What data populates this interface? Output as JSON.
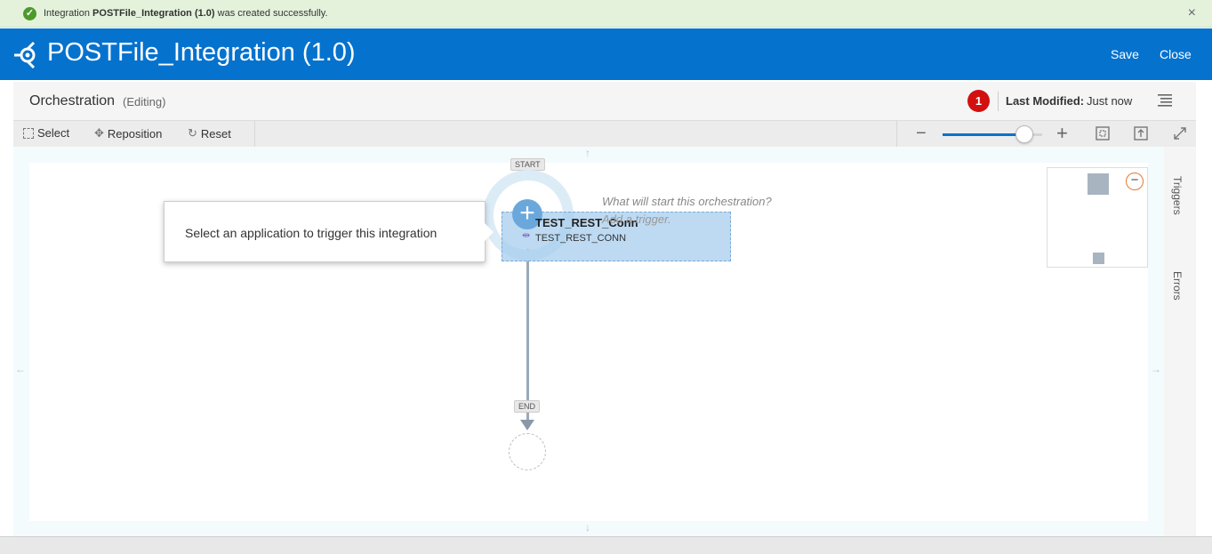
{
  "notification": {
    "prefix": "Integration ",
    "name": "POSTFile_Integration (1.0)",
    "suffix": " was created successfully.",
    "close": "×"
  },
  "header": {
    "title": "POSTFile_Integration (1.0)",
    "save": "Save",
    "close": "Close"
  },
  "subheader": {
    "title": "Orchestration",
    "mode": "(Editing)",
    "issues_count": "1",
    "last_modified_label": "Last Modified:",
    "last_modified_value": "Just now"
  },
  "toolbar": {
    "select": "Select",
    "reposition": "Reposition",
    "reset": "Reset",
    "zoom_level": 0.82
  },
  "canvas": {
    "start_label": "START",
    "end_label": "END",
    "trigger_name": "TEST_REST_Conn",
    "trigger_sub": "TEST_REST_CONN",
    "hint_question": "What will start this orchestration?",
    "hint_action": "Add a trigger.",
    "callout": "Select an application to trigger this integration",
    "arrow_up": "↑",
    "arrow_down": "↓",
    "arrow_left": "←",
    "arrow_right": "→"
  },
  "side_panel": {
    "triggers": "Triggers",
    "errors": "Errors"
  },
  "icons": {
    "success": "check-circle-icon",
    "logo": "integration-logo-icon",
    "menu": "hamburger-menu-icon"
  },
  "colors": {
    "header": "#0572ce",
    "notify_bg": "#e4f2dc",
    "badge": "#d21010",
    "trigger_fill": "#a7ceee"
  }
}
